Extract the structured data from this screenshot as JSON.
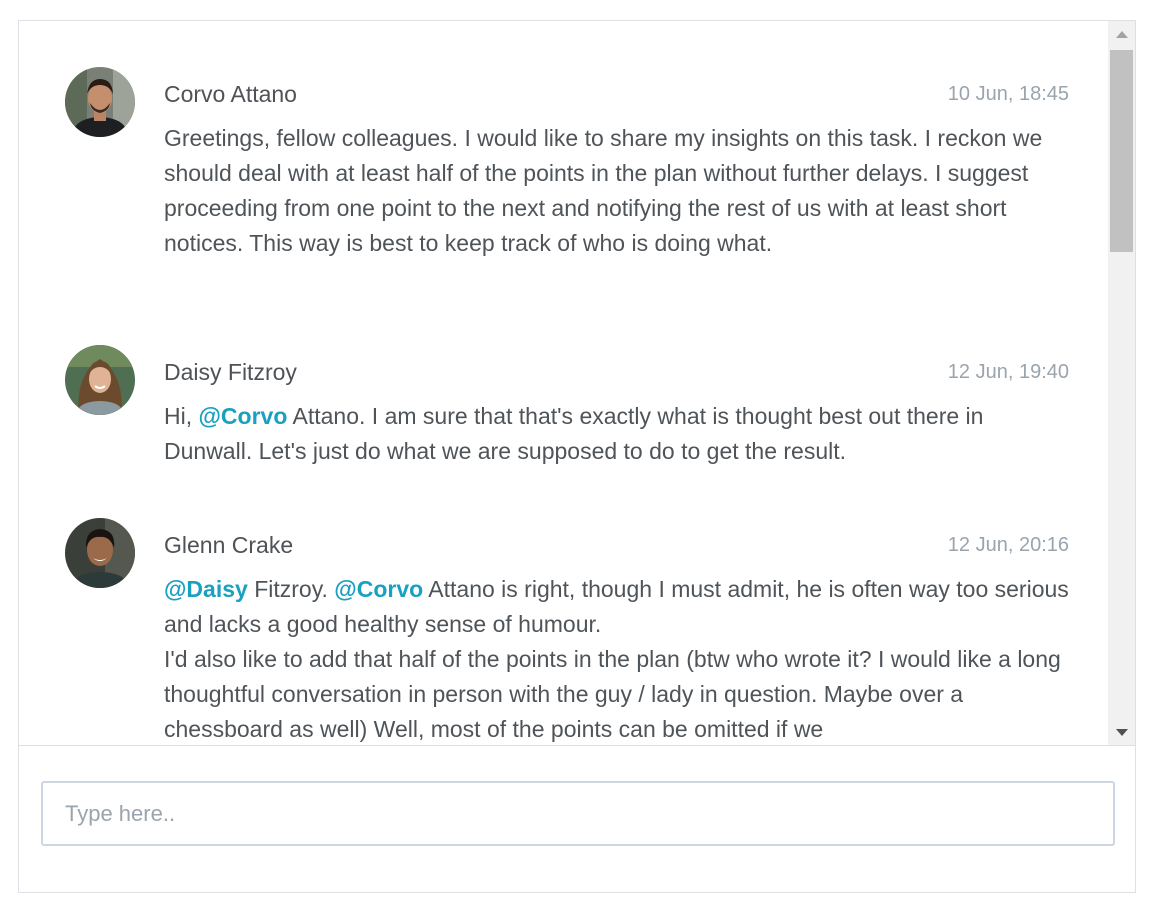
{
  "messages": [
    {
      "author": "Corvo Attano",
      "time": "10 Jun, 18:45",
      "body": [
        {
          "text": "Greetings, fellow colleagues. I would like to share my insights on this task. I reckon we should deal with at least half of the points in the plan without further delays. I suggest proceeding from one point to the next and notifying the rest of us with at least short notices. This way is best to keep track of who is doing what."
        }
      ]
    },
    {
      "author": "Daisy Fitzroy",
      "time": "12 Jun, 19:40",
      "body": [
        {
          "text": "Hi, "
        },
        {
          "mention": "@Corvo"
        },
        {
          "text": " Attano. I am sure that that's exactly what is thought best out there in Dunwall. Let's just do what we are supposed to do to get the result."
        }
      ]
    },
    {
      "author": "Glenn Crake",
      "time": "12 Jun, 20:16",
      "body": [
        {
          "mention": "@Daisy"
        },
        {
          "text": " Fitzroy. "
        },
        {
          "mention": "@Corvo"
        },
        {
          "text": " Attano is right, though I must admit, he is often way too serious and lacks a good healthy sense of humour."
        },
        {
          "break": true
        },
        {
          "text": "I'd also like to add that half of the points in the plan (btw who wrote it? I would like a long thoughtful conversation in person with the guy / lady in question. Maybe over a chessboard as well) Well, most of the points can be omitted if we"
        }
      ]
    }
  ],
  "composer": {
    "placeholder": "Type here.."
  },
  "icons": {
    "scroll_up": "arrow-up-icon",
    "scroll_down": "arrow-down-icon"
  },
  "colors": {
    "mention": "#1aa0c0",
    "timestamp": "#9aa4ad"
  }
}
